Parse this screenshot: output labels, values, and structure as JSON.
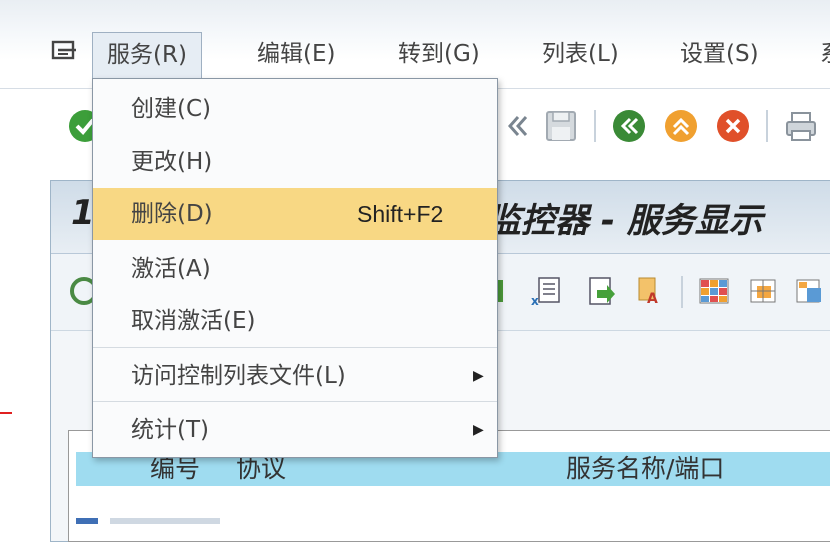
{
  "menubar": {
    "items": [
      {
        "label": "服务(R)",
        "active": true
      },
      {
        "label": "编辑(E)"
      },
      {
        "label": "转到(G)"
      },
      {
        "label": "列表(L)"
      },
      {
        "label": "设置(S)"
      },
      {
        "label": "系"
      }
    ]
  },
  "dropdown": {
    "items": [
      {
        "label": "创建(C)"
      },
      {
        "label": "更改(H)"
      },
      {
        "label": "删除(D)",
        "shortcut": "Shift+F2",
        "highlighted": true
      },
      {
        "label": "激活(A)"
      },
      {
        "label": "取消激活(E)"
      },
      {
        "label": "访问控制列表文件(L)",
        "submenu": true
      },
      {
        "label": "统计(T)",
        "submenu": true
      }
    ]
  },
  "inner_window": {
    "title_lead": "1",
    "title": "监控器 - 服务显示"
  },
  "table": {
    "columns": [
      "编号",
      "协议",
      "服务名称/端口"
    ]
  },
  "colors": {
    "highlight": "#f8d884",
    "table_header": "#9fdcf0",
    "title_gradient": "#cfdce8"
  },
  "icons": {
    "system": "system-menu-icon",
    "toolbar": [
      "enter-icon",
      "back-arrows-icon",
      "save-icon",
      "back-icon",
      "exit-icon",
      "cancel-icon",
      "print-icon"
    ],
    "inner_toolbar": [
      "refresh-icon",
      "excel-export-icon",
      "download-icon",
      "filter-icon",
      "grid-icon",
      "layout-icon",
      "layout-alt-icon"
    ]
  }
}
